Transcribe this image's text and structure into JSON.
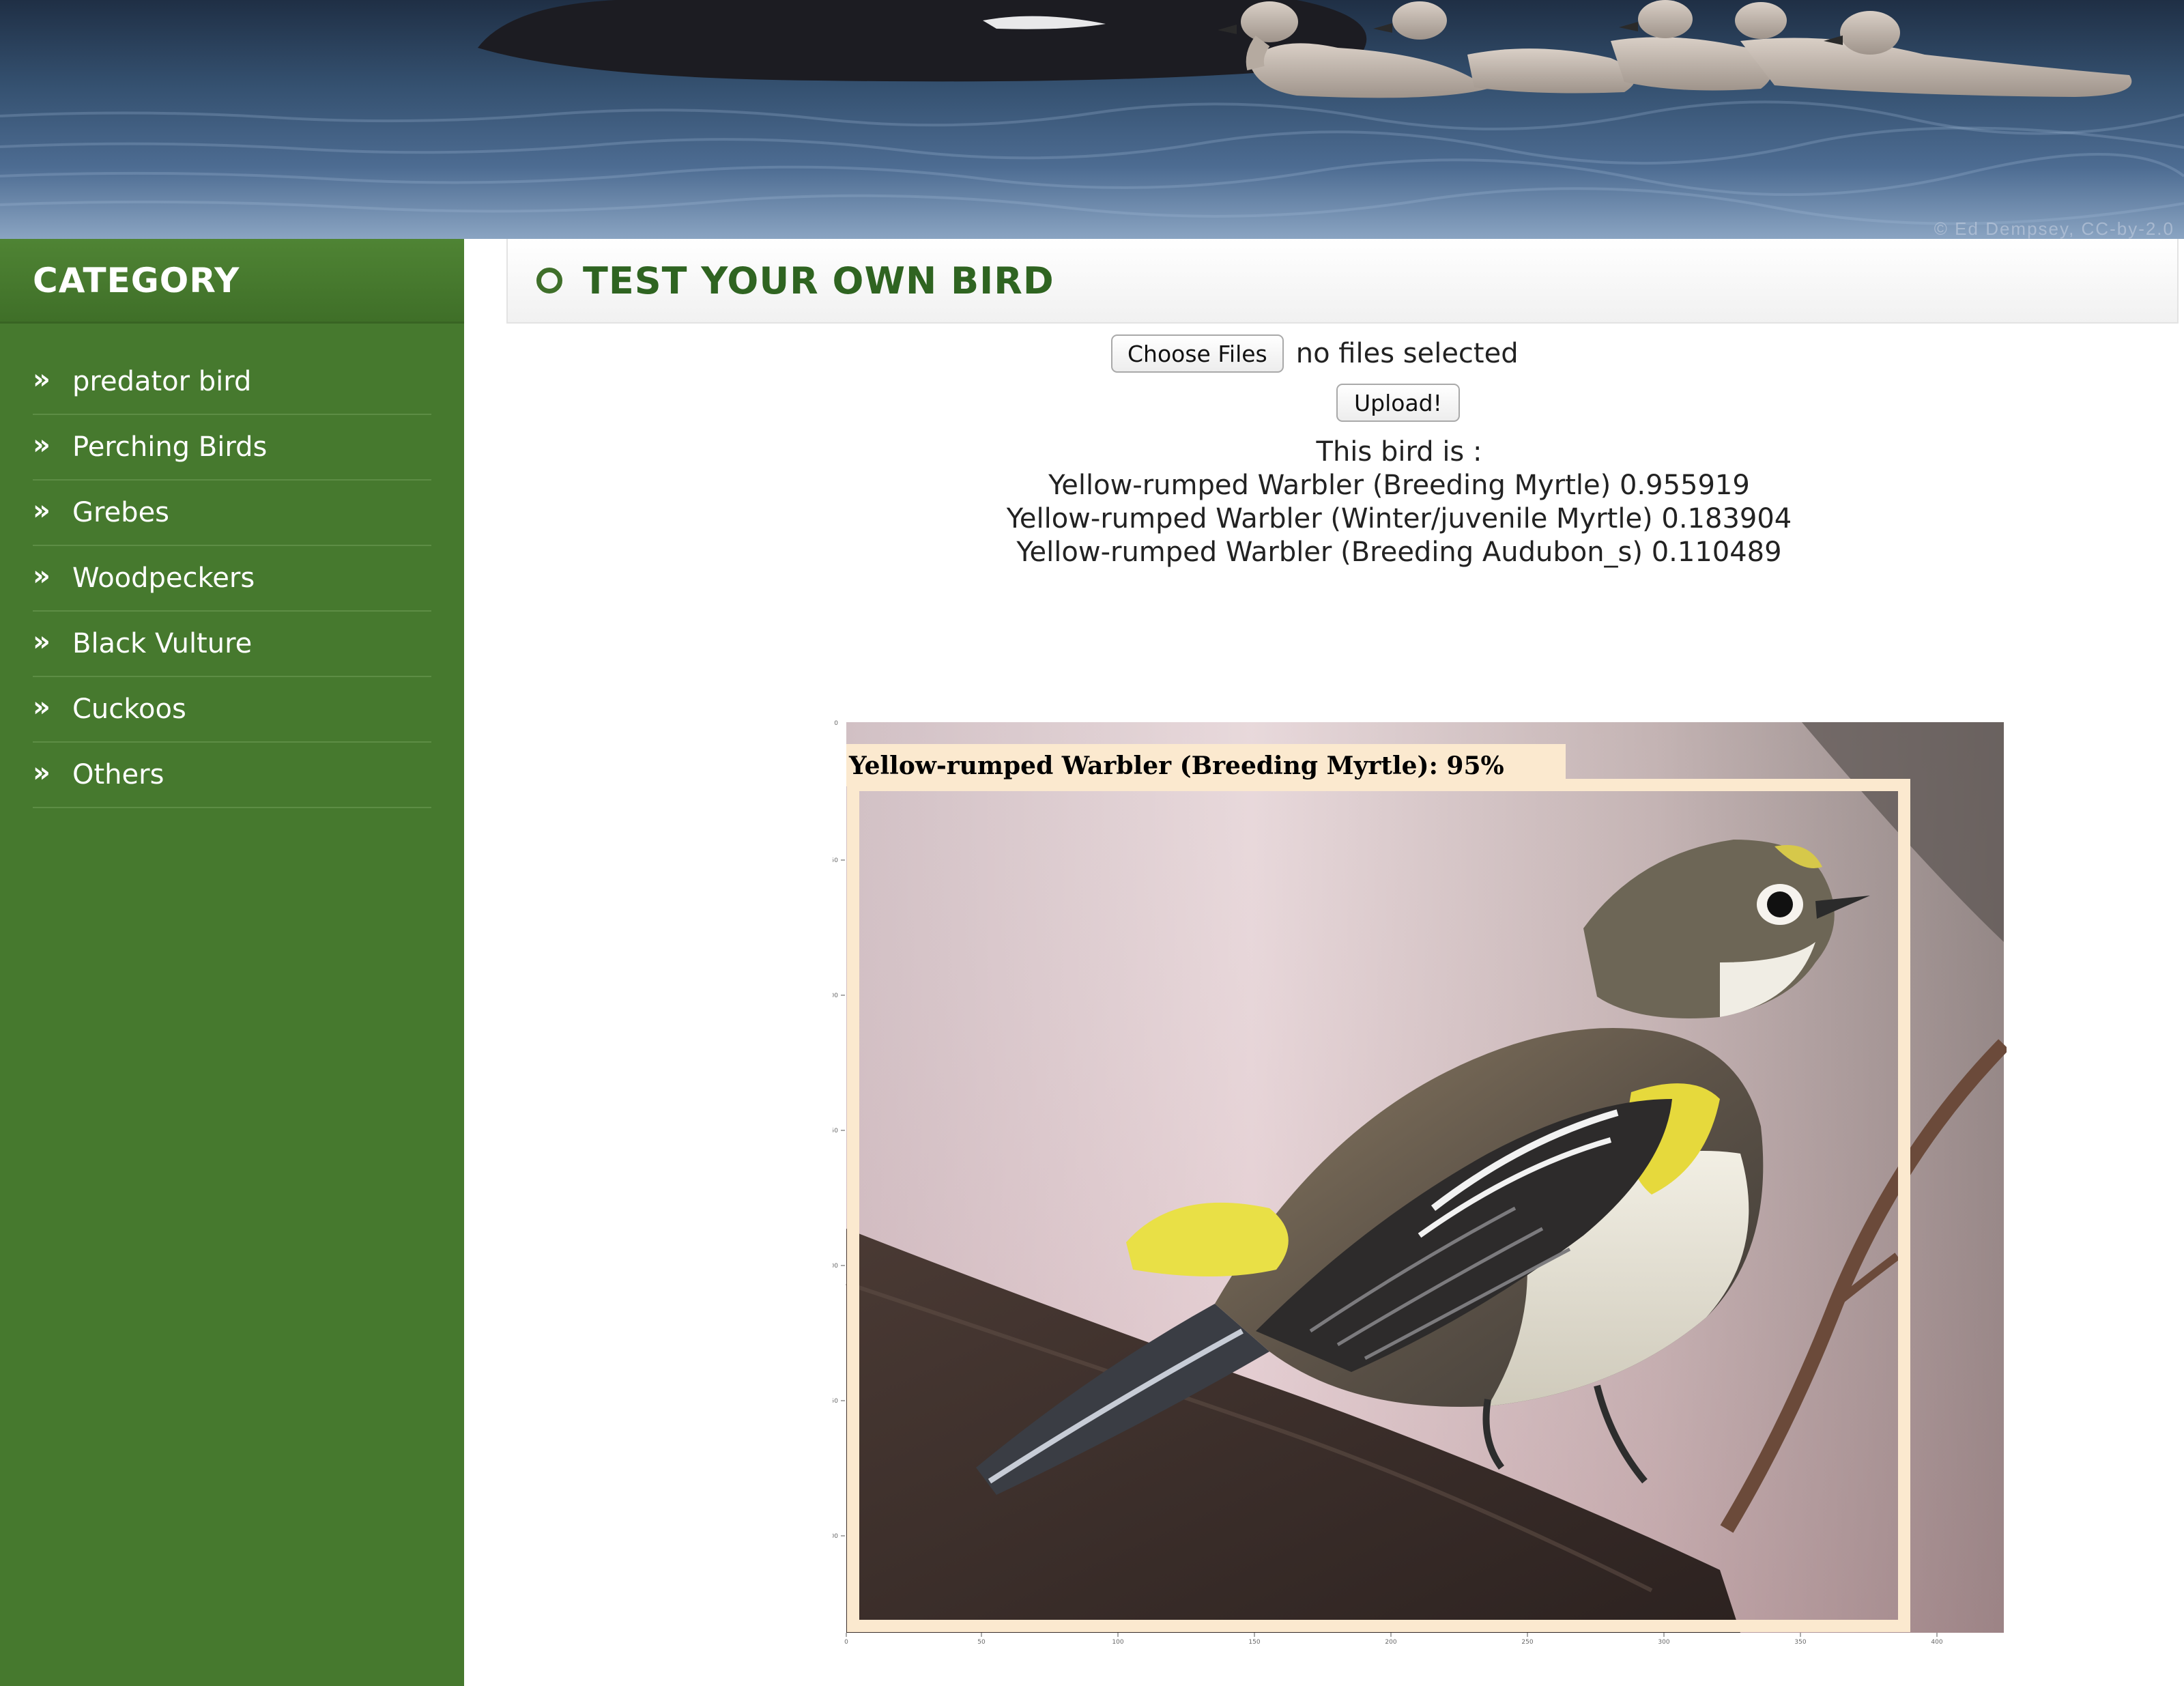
{
  "banner": {
    "copyright": "© Ed Dempsey, CC-by-2.0"
  },
  "sidebar": {
    "title": "CATEGORY",
    "chevron": "»",
    "items": [
      {
        "label": "predator bird"
      },
      {
        "label": "Perching Birds"
      },
      {
        "label": "Grebes"
      },
      {
        "label": "Woodpeckers"
      },
      {
        "label": "Black Vulture"
      },
      {
        "label": "Cuckoos"
      },
      {
        "label": "Others"
      }
    ]
  },
  "main": {
    "section_title": "TEST YOUR OWN BIRD",
    "section_icon": "ring-bullet-icon",
    "choose_files_label": "Choose Files",
    "file_status": "no files selected",
    "upload_label": "Upload!",
    "result_heading": "This bird is :",
    "predictions": [
      {
        "text": "Yellow-rumped Warbler (Breeding Myrtle) 0.955919"
      },
      {
        "text": "Yellow-rumped Warbler (Winter/juvenile Myrtle) 0.183904"
      },
      {
        "text": "Yellow-rumped Warbler (Breeding Audubon_s) 0.110489"
      }
    ]
  },
  "figure": {
    "detection_label": "Yellow-rumped Warbler (Breeding Myrtle): 95%",
    "box_color": "#fbe9cf",
    "y_ticks": [
      "0",
      "50",
      "100",
      "150",
      "200",
      "250",
      "300"
    ],
    "x_ticks": [
      "0",
      "50",
      "100",
      "150",
      "200",
      "250",
      "300",
      "350",
      "400"
    ]
  },
  "colors": {
    "sidebar_bg": "#46792e",
    "title_green": "#2f6421",
    "detection_box": "#fbe9cf"
  }
}
